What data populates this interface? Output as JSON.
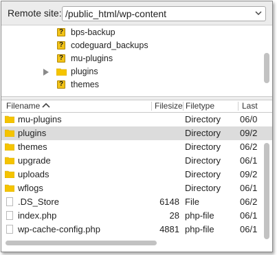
{
  "remote_site": {
    "label": "Remote site:",
    "path": "/public_html/wp-content"
  },
  "tree": {
    "items": [
      {
        "label": "bps-backup",
        "icon": "question-folder-icon"
      },
      {
        "label": "codeguard_backups",
        "icon": "question-folder-icon"
      },
      {
        "label": "mu-plugins",
        "icon": "question-folder-icon"
      },
      {
        "label": "plugins",
        "icon": "folder-icon",
        "expandable": true
      },
      {
        "label": "themes",
        "icon": "question-folder-icon"
      }
    ]
  },
  "list": {
    "columns": {
      "filename": "Filename",
      "filesize": "Filesize",
      "filetype": "Filetype",
      "last": "Last"
    },
    "rows": [
      {
        "name": "mu-plugins",
        "size": "",
        "type": "Directory",
        "last": "06/0",
        "kind": "folder"
      },
      {
        "name": "plugins",
        "size": "",
        "type": "Directory",
        "last": "09/2",
        "kind": "folder",
        "selected": true
      },
      {
        "name": "themes",
        "size": "",
        "type": "Directory",
        "last": "06/2",
        "kind": "folder"
      },
      {
        "name": "upgrade",
        "size": "",
        "type": "Directory",
        "last": "06/1",
        "kind": "folder"
      },
      {
        "name": "uploads",
        "size": "",
        "type": "Directory",
        "last": "09/2",
        "kind": "folder"
      },
      {
        "name": "wflogs",
        "size": "",
        "type": "Directory",
        "last": "06/1",
        "kind": "folder"
      },
      {
        "name": ".DS_Store",
        "size": "6148",
        "type": "File",
        "last": "06/2",
        "kind": "file"
      },
      {
        "name": "index.php",
        "size": "28",
        "type": "php-file",
        "last": "06/1",
        "kind": "file"
      },
      {
        "name": "wp-cache-config.php",
        "size": "4881",
        "type": "php-file",
        "last": "06/1",
        "kind": "file"
      }
    ]
  },
  "colors": {
    "folder": "#f5c400",
    "selected_row": "#dcdcdc"
  }
}
